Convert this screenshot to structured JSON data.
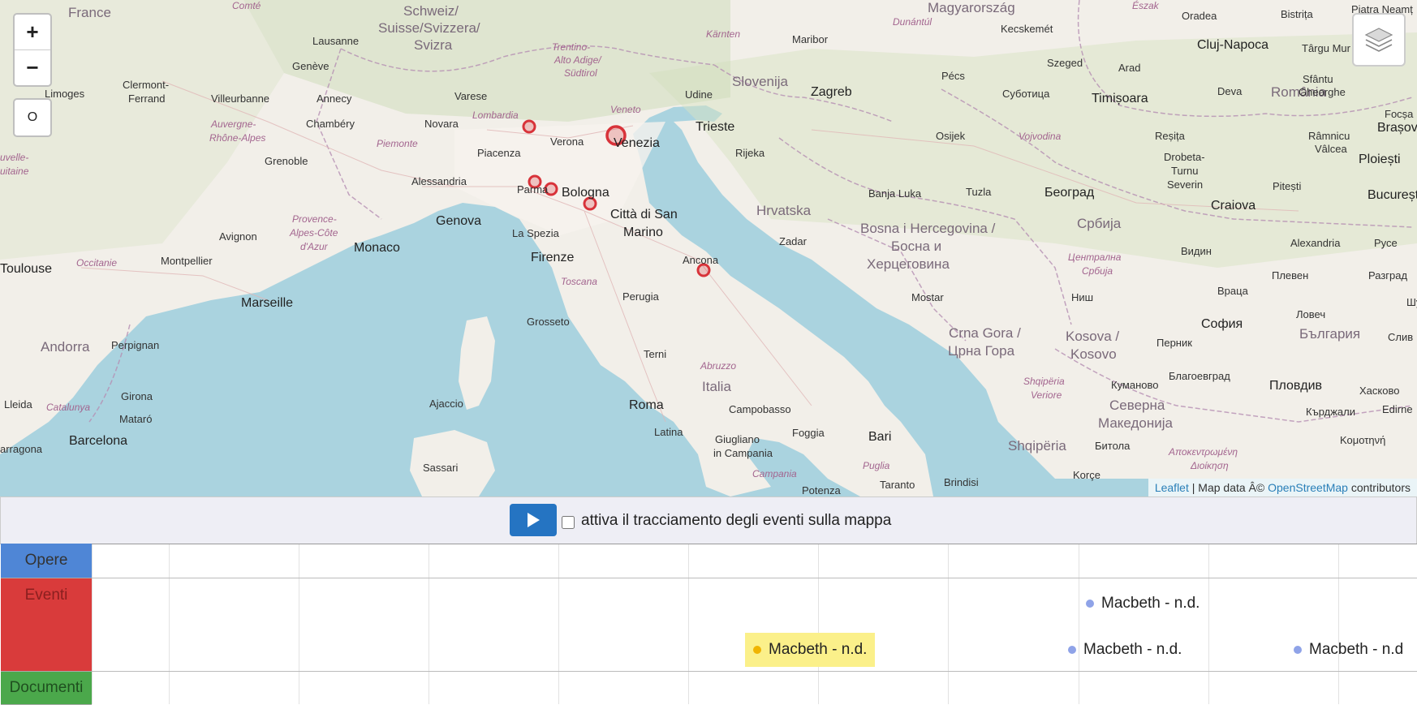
{
  "map": {
    "zoom_in": "+",
    "zoom_out": "−",
    "extra_btn": "O",
    "attribution": {
      "leaflet": "Leaflet",
      "sep": " | Map data Â© ",
      "osm": "OpenStreetMap",
      "tail": " contributors"
    },
    "labels": {
      "france": "France",
      "schweiz": "Schweiz/",
      "suisse": "Suisse/Svizzera/",
      "svizra": "Svizra",
      "slovenija": "Slovenija",
      "hrvatska": "Hrvatska",
      "bih1": "Bosna i Hercegovina /",
      "bih2": "Босна и",
      "bih3": "Херцеговина",
      "srbija": "Србија",
      "romania": "România",
      "balgariya": "България",
      "italia": "Italia",
      "andorra": "Andorra",
      "monaco": "Monaco",
      "crna1": "Crna Gora /",
      "crna2": "Црна Гора",
      "kosova1": "Kosova /",
      "kosova2": "Kosovo",
      "makedonija1": "Северна",
      "makedonija2": "Македонија",
      "shqiperia": "Shqipëria",
      "magyar": "Magyarország",
      "lausanne": "Lausanne",
      "geneve": "Genève",
      "limoges": "Limoges",
      "clermont1": "Clermont-",
      "clermont2": "Ferrand",
      "villeurbanne": "Villeurbanne",
      "annecy": "Annecy",
      "chambery": "Chambéry",
      "grenoble": "Grenoble",
      "avignon": "Avignon",
      "montpellier": "Montpellier",
      "marseille": "Marseille",
      "toulouse": "Toulouse",
      "perpignan": "Perpignan",
      "girona": "Girona",
      "lleida": "Lleida",
      "mataro": "Mataró",
      "barcelona": "Barcelona",
      "tarragona": "arragona",
      "ajaccio": "Ajaccio",
      "sassari": "Sassari",
      "varese": "Varese",
      "novara": "Novara",
      "verona": "Verona",
      "piacenza": "Piacenza",
      "alessandria": "Alessandria",
      "genova": "Genova",
      "parma": "Parma",
      "bologna": "Bologna",
      "laspezia": "La Spezia",
      "firenze": "Firenze",
      "venezia": "Venezia",
      "udine": "Udine",
      "trieste": "Trieste",
      "rijeka": "Rijeka",
      "sanmarino1": "Città di San",
      "sanmarino2": "Marino",
      "ancona": "Ancona",
      "perugia": "Perugia",
      "grosseto": "Grosseto",
      "terni": "Terni",
      "roma": "Roma",
      "latina": "Latina",
      "campobasso": "Campobasso",
      "foggia": "Foggia",
      "bari": "Bari",
      "giugliano1": "Giugliano",
      "giugliano2": "in Campania",
      "taranto": "Taranto",
      "brindisi": "Brindisi",
      "potenza": "Potenza",
      "zagreb": "Zagreb",
      "maribor": "Maribor",
      "pecs": "Pécs",
      "osijek": "Osijek",
      "banjaluka": "Banja Luka",
      "tuzla": "Tuzla",
      "zadar": "Zadar",
      "mostar": "Mostar",
      "beograd": "Београд",
      "szeged": "Szeged",
      "kecskemet": "Kecskemét",
      "subotica": "Суботица",
      "timisoara": "Timișoara",
      "arad": "Arad",
      "oradea": "Oradea",
      "cluj": "Cluj-Napoca",
      "targumures": "Târgu Mur",
      "bistrita": "Bistrița",
      "deva": "Deva",
      "resita": "Reșița",
      "drobeta1": "Drobeta-",
      "drobeta2": "Turnu",
      "drobeta3": "Severin",
      "craiova": "Craiova",
      "pitesti": "Pitești",
      "bucuresti": "București",
      "ploiesti": "Ploiești",
      "brasov": "Brașov",
      "ramnicu1": "Râmnicu",
      "ramnicu2": "Vâlcea",
      "sfantu1": "Sfântu",
      "sfantu2": "Gheorghe",
      "alexandria": "Alexandria",
      "ruse": "Русе",
      "vidin": "Видин",
      "pleven": "Плевен",
      "razgrad": "Разград",
      "shu": "Шу",
      "vratsa": "Враца",
      "lovech": "Ловеч",
      "nish": "Ниш",
      "sofia": "София",
      "pernik": "Перник",
      "kumanovo": "Куманово",
      "blagoevgrad": "Благоевград",
      "plovdiv": "Пловдив",
      "haskovo": "Хасково",
      "kardzhali": "Кърджали",
      "edirne": "Edirne",
      "komotini": "Κομοτηνή",
      "bitola": "Битола",
      "korce": "Korçe",
      "sliv": "Слив",
      "focsa": "Focșa",
      "piatra": "Piatra Neamț",
      "lombardia": "Lombardia",
      "veneto": "Veneto",
      "piemonte": "Piemonte",
      "toscana": "Toscana",
      "abruzzo": "Abruzzo",
      "campania": "Campania",
      "puglia": "Puglia",
      "trentino1": "Trentino-",
      "trentino2": "Alto Adige/",
      "trentino3": "Südtirol",
      "karnten": "Kärnten",
      "dunantul": "Dunántúl",
      "auvergne1": "Auvergne-",
      "auvergne2": "Rhône-Alpes",
      "provence1": "Provence-",
      "provence2": "Alpes-Côte",
      "provence3": "d'Azur",
      "occitanie": "Occitanie",
      "catalunya": "Catalunya",
      "vojvodina": "Vojvodina",
      "centralna1": "Централна",
      "centralna2": "Србија",
      "shqiperia_v1": "Shqipëria",
      "shqiperia_v2": "Veriore",
      "anatoliki1": "Αποκεντρωμένη",
      "anatoliki2": "Διοίκηση",
      "comte": "Comté",
      "eszak": "Észak",
      "uvelle1": "uvelle-",
      "uvelle2": "uitaine"
    }
  },
  "controls": {
    "trace_label": "attiva il tracciamento degli eventi sulla mappa",
    "trace_checked": false
  },
  "timeline": {
    "groups": [
      {
        "label": "Opere",
        "color": "#4f86d6",
        "text_color": "#333333"
      },
      {
        "label": "Eventi",
        "color": "#d93b3b",
        "text_color": "#8a1f1f"
      },
      {
        "label": "Documenti",
        "color": "#4ba84b",
        "text_color": "#1f4f1f"
      }
    ],
    "items": [
      {
        "label": "Macbeth - n.d.",
        "dot_color": "#f0b400",
        "highlighted": true,
        "highlight_color": "#fbf08a"
      },
      {
        "label": "Macbeth - n.d.",
        "dot_color": "#8fa3e8",
        "highlighted": false
      },
      {
        "label": "Macbeth - n.d.",
        "dot_color": "#8fa3e8",
        "highlighted": false
      },
      {
        "label": "Macbeth - n.d",
        "dot_color": "#8fa3e8",
        "highlighted": false
      }
    ]
  }
}
